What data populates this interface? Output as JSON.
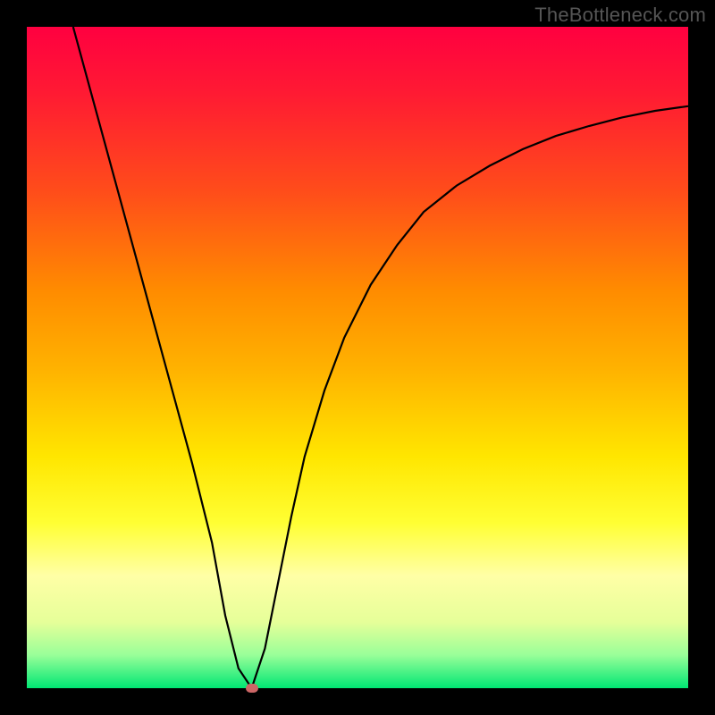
{
  "watermark": "TheBottleneck.com",
  "colors": {
    "page_bg": "#000000",
    "curve_stroke": "#000000",
    "marker_fill": "#cc6666"
  },
  "chart_data": {
    "type": "line",
    "title": "",
    "xlabel": "",
    "ylabel": "",
    "xlim": [
      0,
      100
    ],
    "ylim": [
      0,
      100
    ],
    "grid": false,
    "series": [
      {
        "name": "bottleneck-curve",
        "x": [
          7,
          10,
          13,
          16,
          19,
          22,
          25,
          28,
          30,
          32,
          34,
          36,
          38,
          40,
          42,
          45,
          48,
          52,
          56,
          60,
          65,
          70,
          75,
          80,
          85,
          90,
          95,
          100
        ],
        "y": [
          100,
          89,
          78,
          67,
          56,
          45,
          34,
          22,
          11,
          3,
          0,
          6,
          16,
          26,
          35,
          45,
          53,
          61,
          67,
          72,
          76,
          79,
          81.5,
          83.5,
          85,
          86.3,
          87.3,
          88
        ]
      }
    ],
    "marker": {
      "name": "optimal-point",
      "x": 34,
      "y": 0
    }
  }
}
